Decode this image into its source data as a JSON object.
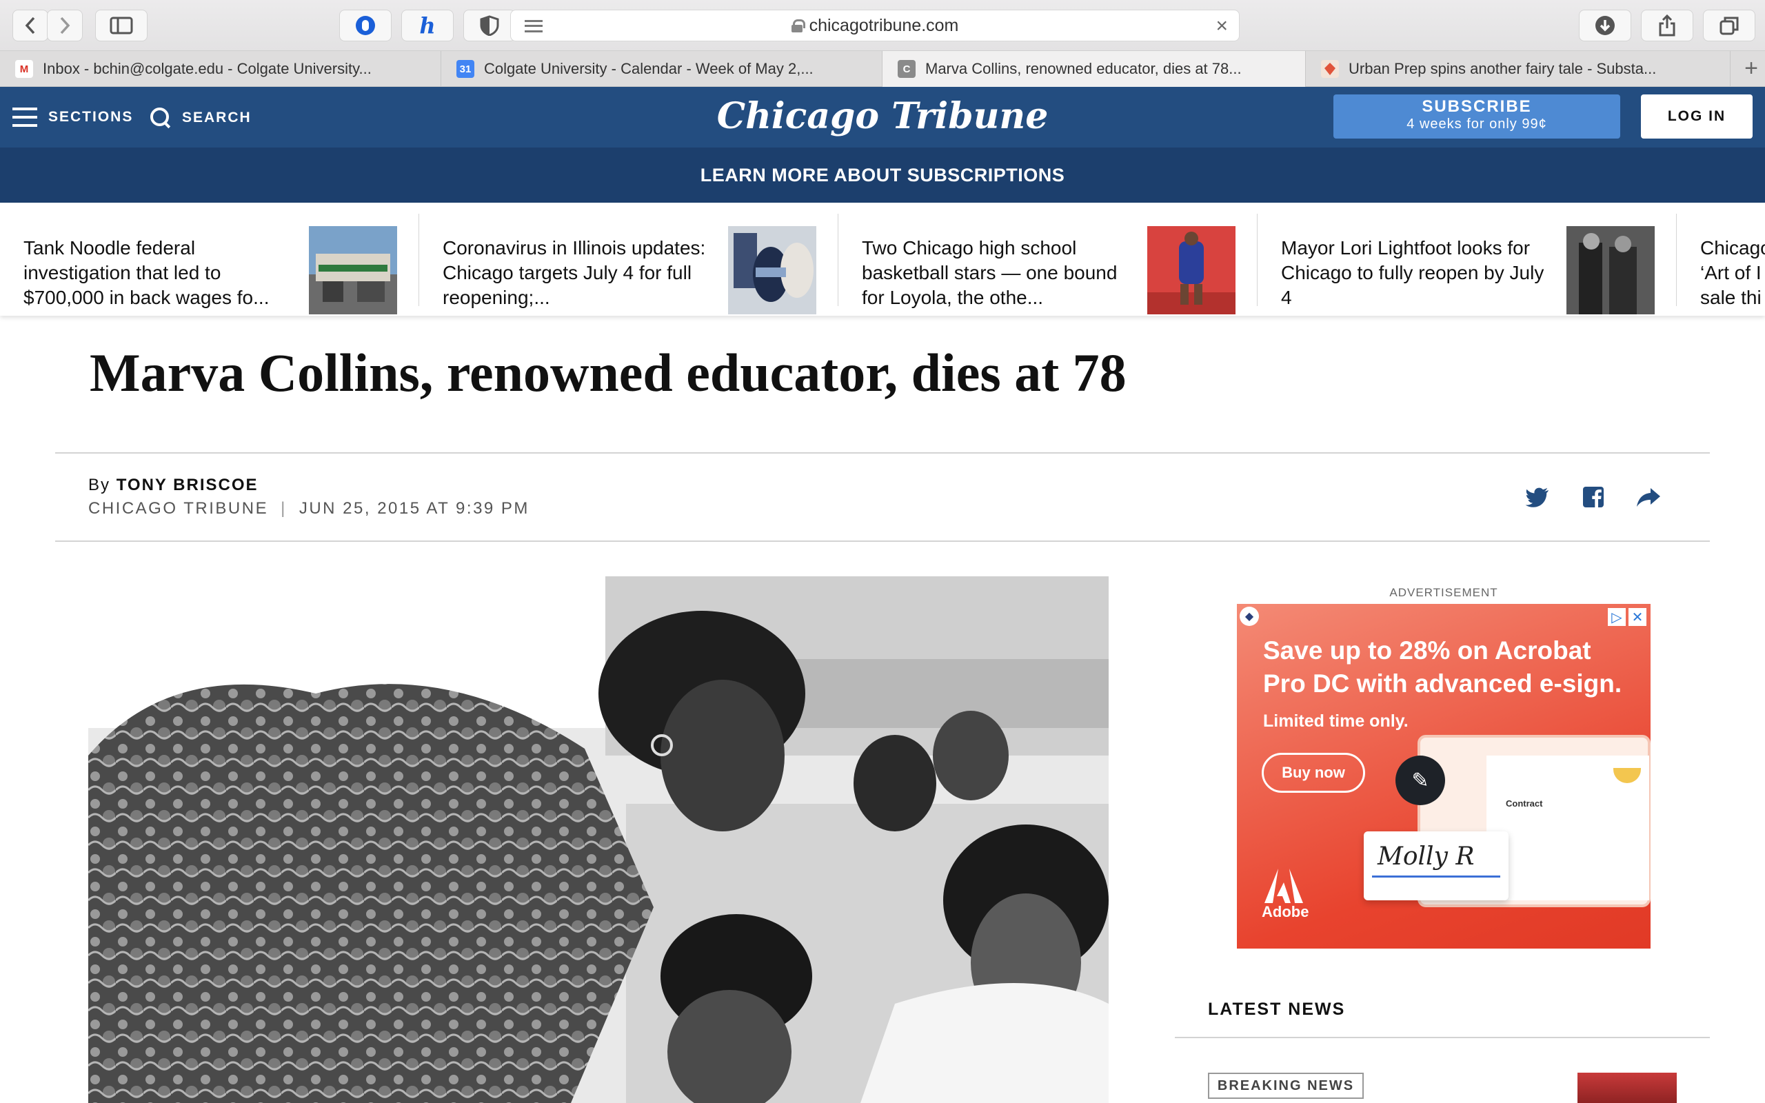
{
  "browser": {
    "url": "chicagotribune.com",
    "tabs": [
      {
        "favicon": "M",
        "favicon_color": "#d93025",
        "title": "Inbox - bchin@colgate.edu - Colgate University..."
      },
      {
        "favicon": "31",
        "favicon_color": "#4285f4",
        "title": "Colgate University - Calendar - Week of May 2,..."
      },
      {
        "favicon": "C",
        "favicon_color": "#8a8a8a",
        "title": "Marva Collins, renowned educator, dies at 78..."
      },
      {
        "favicon": "",
        "favicon_color": "#e0533a",
        "title": "Urban Prep spins another fairy tale - Substa..."
      }
    ],
    "new_tab_label": "+"
  },
  "site": {
    "logo": "Chicago Tribune",
    "sections_label": "SECTIONS",
    "search_label": "SEARCH",
    "subscribe_label": "SUBSCRIBE",
    "subscribe_offer": "4 weeks for only 99¢",
    "login_label": "LOG IN",
    "promo_banner": "LEARN MORE ABOUT SUBSCRIPTIONS"
  },
  "ticker": [
    {
      "text": "Tank Noodle federal investigation that led to $700,000 in back wages fo..."
    },
    {
      "text": "Coronavirus in Illinois updates: Chicago targets July 4 for full reopening;..."
    },
    {
      "text": "Two Chicago high school basketball stars — one bound for Loyola, the othe..."
    },
    {
      "text": "Mayor Lori Lightfoot looks for Chicago to fully reopen by July 4"
    },
    {
      "text": "Chicago ‘Art of I sale thi"
    }
  ],
  "article": {
    "headline": "Marva Collins, renowned educator, dies at 78",
    "byline_prefix": "By",
    "author": "TONY BRISCOE",
    "publication": "CHICAGO TRIBUNE",
    "date": "JUN 25, 2015 AT 9:39 PM"
  },
  "ad": {
    "label": "ADVERTISEMENT",
    "headline": "Save up to 28% on Acrobat Pro DC with advanced e-sign.",
    "subtext": "Limited time only.",
    "button": "Buy now",
    "brand": "Adobe",
    "doc_title": "Contract",
    "signature": "Molly R"
  },
  "sidebar": {
    "latest_news": "LATEST NEWS",
    "badge": "BREAKING NEWS"
  }
}
